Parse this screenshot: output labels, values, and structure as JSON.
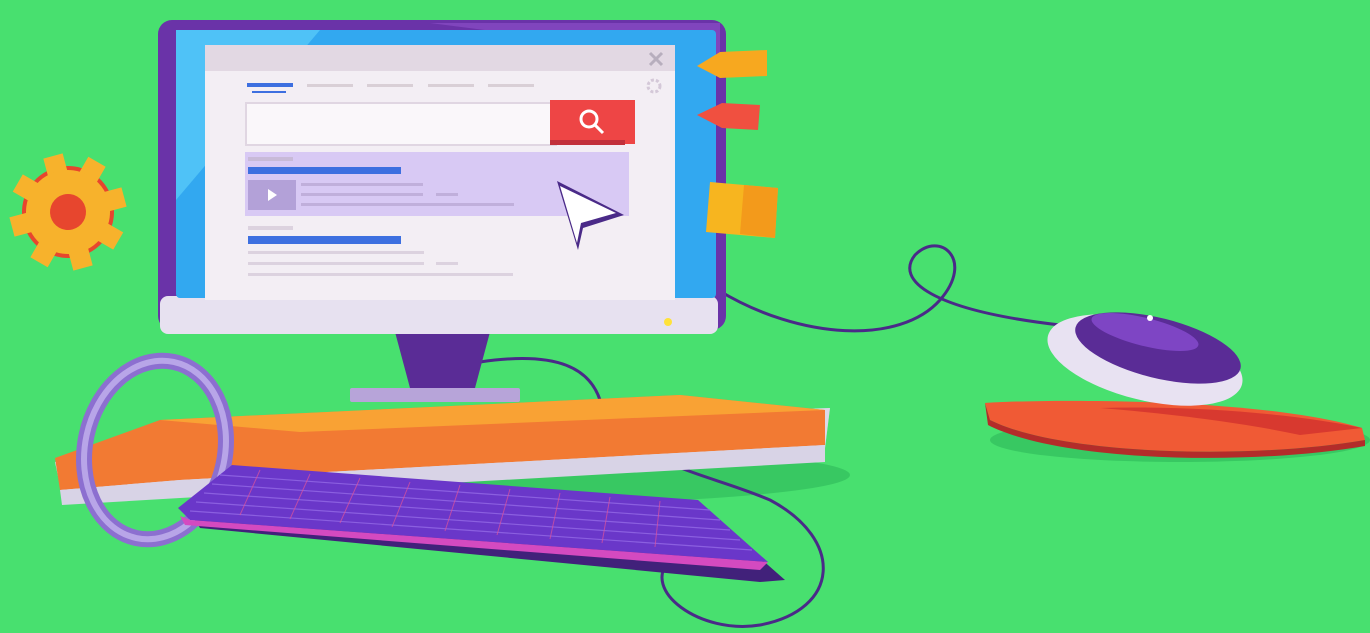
{
  "scene": {
    "background": "#48e06f",
    "colors": {
      "monitor_frame": "#6a33a8",
      "screen_blue": "#32a8f0",
      "window_bg": "#f3eef4",
      "accent_blue": "#3d6fe0",
      "search_button": "#ee4545",
      "highlight_row": "#d8c9f4",
      "desk_orange": "#f27a33",
      "keyboard": "#6a37c9",
      "gear": "#f7b22c",
      "sticky_note": "#f7b51f"
    }
  },
  "browser_window": {
    "close_icon": "close-icon",
    "settings_icon": "gear-icon",
    "active_tab_index": 0,
    "tab_count": 5
  },
  "search": {
    "button_icon": "search-icon"
  },
  "results": {
    "count": 2,
    "first_has_video_thumbnail": true,
    "highlighted_result_index": 0
  },
  "decorations": {
    "icons": [
      "gear-icon",
      "sticky-note-icon",
      "cursor-arrow-icon",
      "mouse-icon",
      "keyboard-icon",
      "cable-icon"
    ]
  }
}
